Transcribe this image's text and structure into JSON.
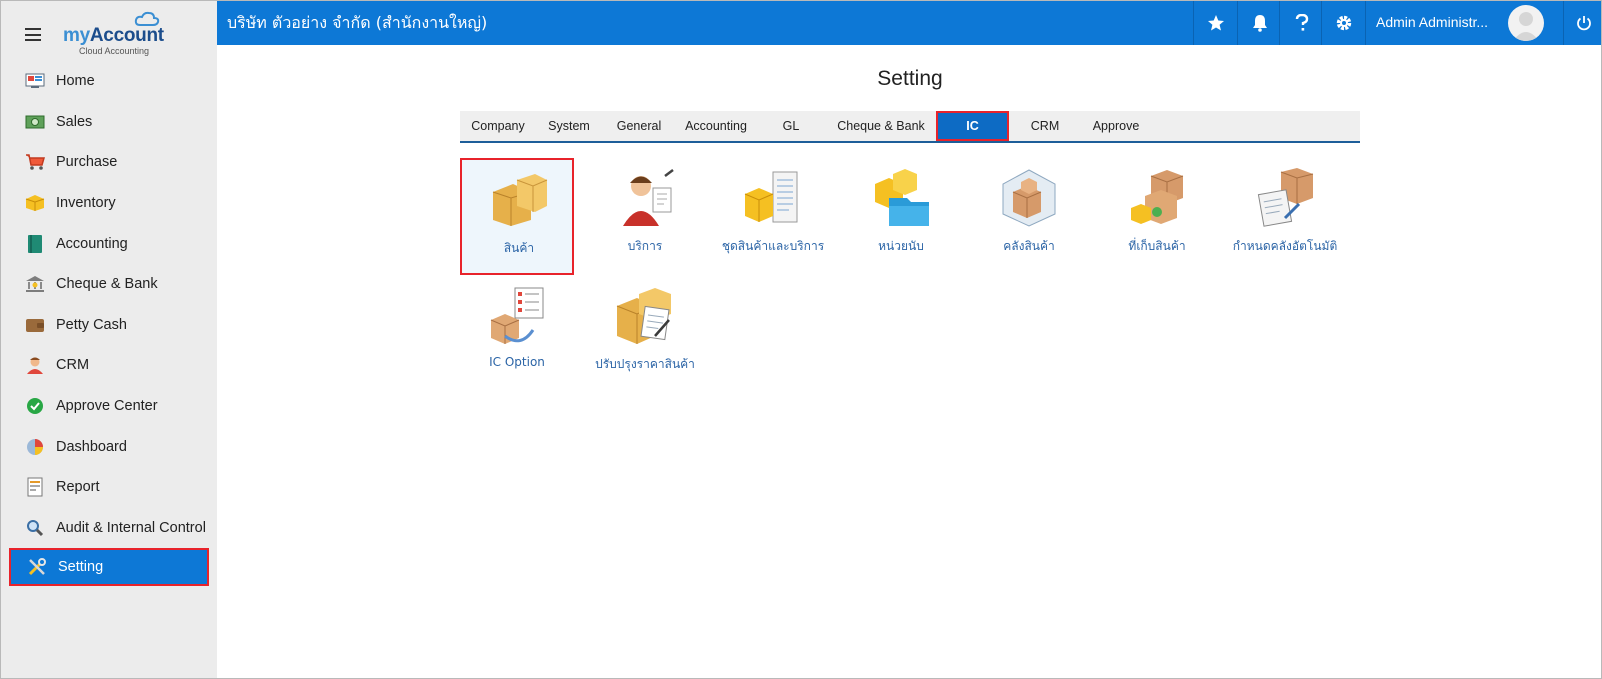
{
  "brand": {
    "logo_prefix": "my",
    "logo_main": "Account",
    "logo_sub": "Cloud Accounting"
  },
  "sidebar": {
    "items": [
      {
        "label": "Home",
        "icon": "home-icon"
      },
      {
        "label": "Sales",
        "icon": "money-icon"
      },
      {
        "label": "Purchase",
        "icon": "cart-icon"
      },
      {
        "label": "Inventory",
        "icon": "box-icon"
      },
      {
        "label": "Accounting",
        "icon": "book-icon"
      },
      {
        "label": "Cheque & Bank",
        "icon": "bank-icon"
      },
      {
        "label": "Petty Cash",
        "icon": "wallet-icon"
      },
      {
        "label": "CRM",
        "icon": "people-icon"
      },
      {
        "label": "Approve Center",
        "icon": "check-circle-icon"
      },
      {
        "label": "Dashboard",
        "icon": "pie-chart-icon"
      },
      {
        "label": "Report",
        "icon": "report-icon"
      },
      {
        "label": "Audit & Internal Control",
        "icon": "magnifier-icon"
      },
      {
        "label": "Setting",
        "icon": "tools-icon",
        "active": true
      }
    ]
  },
  "header": {
    "company": "บริษัท ตัวอย่าง จำกัด (สำนักงานใหญ่)",
    "user_name": "Admin Administr...",
    "icons": [
      "star-icon",
      "bell-icon",
      "help-icon",
      "gear-icon",
      "power-icon"
    ]
  },
  "main": {
    "title": "Setting",
    "tabs": [
      {
        "label": "Company"
      },
      {
        "label": "System"
      },
      {
        "label": "General"
      },
      {
        "label": "Accounting"
      },
      {
        "label": "GL"
      },
      {
        "label": "Cheque & Bank"
      },
      {
        "label": "IC",
        "active": true
      },
      {
        "label": "CRM"
      },
      {
        "label": "Approve"
      }
    ],
    "tiles": [
      {
        "label": "สินค้า",
        "icon": "product-boxes-icon",
        "selected": true
      },
      {
        "label": "บริการ",
        "icon": "service-person-icon"
      },
      {
        "label": "ชุดสินค้าและบริการ",
        "icon": "product-set-icon"
      },
      {
        "label": "หน่วยนับ",
        "icon": "unit-folder-icon"
      },
      {
        "label": "คลังสินค้า",
        "icon": "warehouse-icon"
      },
      {
        "label": "ที่เก็บสินค้า",
        "icon": "storage-location-icon"
      },
      {
        "label": "กำหนดคลังอัตโนมัติ",
        "icon": "auto-warehouse-icon"
      },
      {
        "label": "IC Option",
        "icon": "ic-option-icon"
      },
      {
        "label": "ปรับปรุงราคาสินค้า",
        "icon": "price-adjust-icon"
      }
    ]
  },
  "colors": {
    "primary": "#0d78d6",
    "highlight": "#e8232b",
    "sidebar_bg": "#ececec",
    "link": "#2b64a6"
  }
}
